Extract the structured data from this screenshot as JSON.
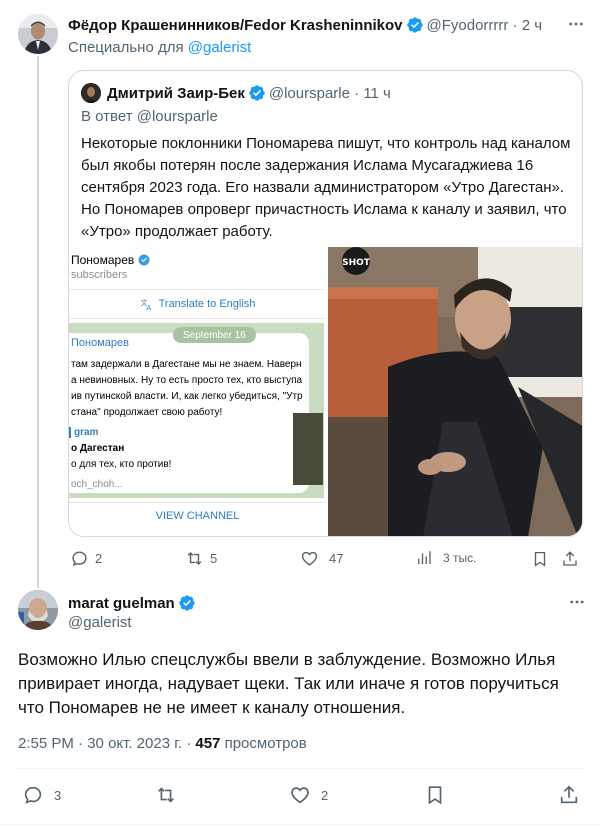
{
  "parent_tweet": {
    "author_name": "Фёдор Крашенинников/Fedor Krasheninnikov",
    "handle": "@Fyodorrrrr",
    "time": "2 ч",
    "exclusive_prefix": "Специально для ",
    "exclusive_target": "@galerist",
    "quote": {
      "author_name": "Дмитрий Заир-Бек",
      "handle": "@loursparle",
      "time": "11 ч",
      "reply_prefix": "В ответ ",
      "reply_target": "@loursparle",
      "text": "Некоторые поклонники Пономарева пишут, что контроль над каналом был якобы потерян после задержания Ислама Мусагаджиева 16 сентября 2023 года. Его назвали администратором «Утро Дагестан». Но Пономарев опроверг причастность Ислама к каналу и заявил, что «Утро» продолжает работу.",
      "screenshot": {
        "channel_title": "Пономарев",
        "subscribers": "subscribers",
        "translate": "Translate to English",
        "date": "September 16",
        "sender": "Пономарев",
        "lines": [
          "там задержали в Дагестане мы не знаем. Наверн",
          "а невиновных. Ну то есть просто тех, кто выступа",
          "ив путинской власти. И, как легко убедиться, \"Утр",
          "стана\" продолжает свою работу!"
        ],
        "forward_label": "gram",
        "forward_title": "о Дагестан",
        "forward_text": "о для тех, кто против!",
        "forward_link": "och_choh...",
        "view_channel": "VIEW CHANNEL"
      },
      "photo_watermark": "SHOT"
    },
    "actions": {
      "replies": "2",
      "reposts": "5",
      "likes": "47",
      "views": "3 тыс."
    }
  },
  "reply_tweet": {
    "author_name": "marat guelman",
    "handle": "@galerist",
    "text": "Возможно Илью спецслужбы ввели в заблуждение. Возможно Илья привирает иногда, надувает щеки. Так или иначе я готов поручиться что Пономарев не не имеет к каналу отношения.",
    "time": "2:55 PM",
    "date": "30 окт. 2023 г.",
    "views_count": "457",
    "views_label": "просмотров",
    "actions": {
      "replies": "3",
      "likes": "2"
    }
  },
  "colors": {
    "accent": "#1d9bf0",
    "text": "#0f1419",
    "muted": "#536471"
  }
}
